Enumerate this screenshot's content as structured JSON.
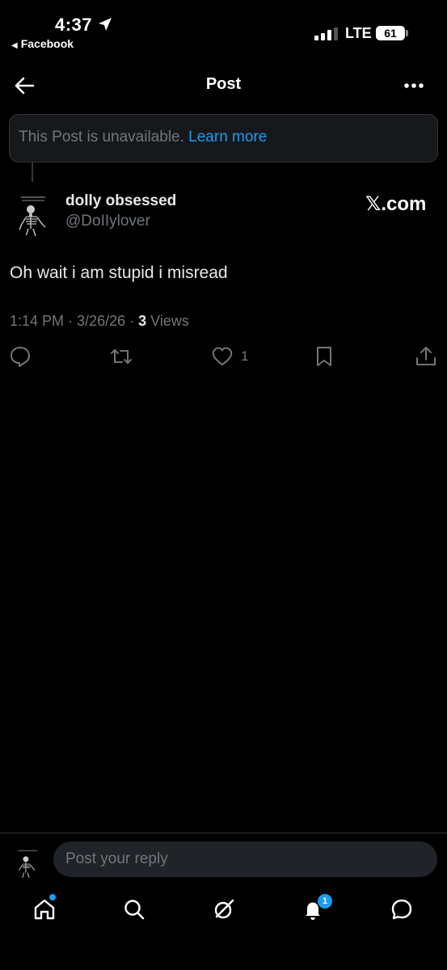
{
  "status_bar": {
    "time": "4:37",
    "back_app": "Facebook",
    "network": "LTE",
    "battery": "61",
    "signal_bars": 3
  },
  "header": {
    "title": "Post"
  },
  "unavailable": {
    "text": "This Post is unavailable.",
    "link": "Learn more"
  },
  "post": {
    "display_name": "dolly obsessed",
    "handle": "@DoIIylover",
    "source_label": "𝕏.com",
    "text": "Oh wait i am stupid i misread",
    "time": "1:14 PM",
    "date": "3/26/26",
    "views_count": "3",
    "views_label": "Views",
    "like_count": "1"
  },
  "reply": {
    "placeholder": "Post your reply"
  },
  "tabbar": {
    "notifications_badge": "1"
  },
  "colors": {
    "background": "#000000",
    "accent": "#1d9bf0",
    "secondary_text": "#71767b",
    "primary_text": "#e7e9ea"
  }
}
